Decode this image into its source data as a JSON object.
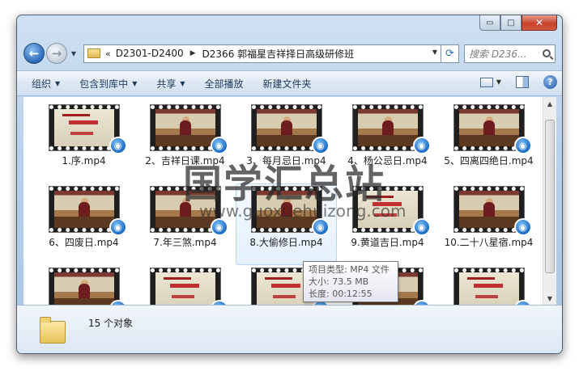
{
  "window": {
    "caption": {
      "minimize": "▭",
      "maximize": "□",
      "close": "✕"
    }
  },
  "address": {
    "breadcrumb": [
      "D2301-D2400",
      "D2366 郭福星吉祥择日高级研修班"
    ],
    "search_placeholder": "搜索 D236..."
  },
  "toolbar": {
    "items": [
      "组织",
      "包含到库中",
      "共享",
      "全部播放",
      "新建文件夹"
    ]
  },
  "files": [
    {
      "name": "1.序.mp4",
      "thumb": "title"
    },
    {
      "name": "2、吉祥日课.mp4",
      "thumb": "speaker"
    },
    {
      "name": "3、每月忌日.mp4",
      "thumb": "speaker"
    },
    {
      "name": "4、杨公忌日.mp4",
      "thumb": "speaker"
    },
    {
      "name": "5、四离四绝日.mp4",
      "thumb": "speaker"
    },
    {
      "name": "6、四废日.mp4",
      "thumb": "speaker"
    },
    {
      "name": "7.年三煞.mp4",
      "thumb": "speaker"
    },
    {
      "name": "8.大偷修日.mp4",
      "thumb": "speaker"
    },
    {
      "name": "9.黄道吉日.mp4",
      "thumb": "title"
    },
    {
      "name": "10.二十八星宿.mp4",
      "thumb": "speaker"
    },
    {
      "name": "",
      "thumb": "speaker"
    },
    {
      "name": "",
      "thumb": "title"
    },
    {
      "name": "",
      "thumb": "title"
    },
    {
      "name": "",
      "thumb": "speaker"
    },
    {
      "name": "",
      "thumb": "title"
    }
  ],
  "tooltip": {
    "type": "项目类型: MP4 文件",
    "size": "大小: 73.5 MB",
    "length": "长度: 00:12:55"
  },
  "details": {
    "count": "15 个对象"
  },
  "watermark": {
    "text": "国学汇总站",
    "url": "www.guoxuehuizong.com"
  }
}
